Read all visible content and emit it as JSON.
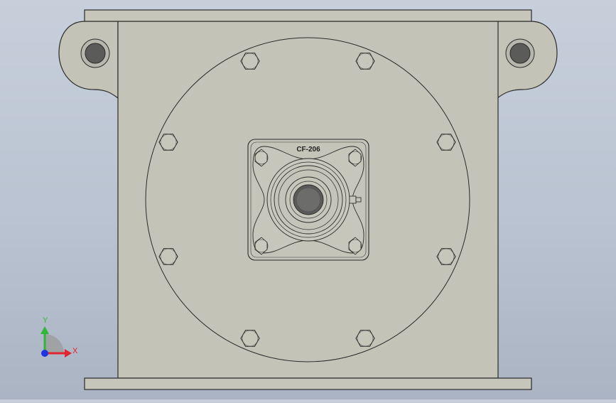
{
  "viewport": {
    "background_top": "#c7cfdb",
    "background_bottom": "#aab4c3"
  },
  "model": {
    "part_color": "#c3c3b8",
    "edge_color": "#2b2b2b",
    "bearing_label": "CF-206"
  },
  "triad": {
    "x_label": "X",
    "y_label": "Y",
    "x_color": "#e0262e",
    "y_color": "#33b53a",
    "z_color": "#1f35e0"
  }
}
